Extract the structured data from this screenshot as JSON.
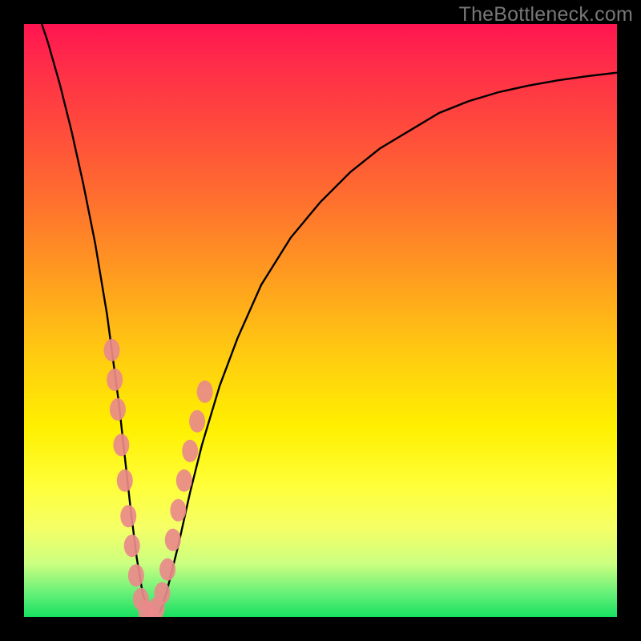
{
  "watermark": "TheBottleneck.com",
  "chart_data": {
    "type": "line",
    "title": "",
    "xlabel": "",
    "ylabel": "",
    "xlim": [
      0,
      100
    ],
    "ylim": [
      0,
      100
    ],
    "grid": false,
    "series": [
      {
        "name": "bottleneck-curve",
        "x": [
          0,
          2,
          4,
          6,
          8,
          10,
          12,
          14,
          16,
          17,
          18,
          19,
          20,
          21,
          22,
          23,
          24,
          26,
          28,
          30,
          33,
          36,
          40,
          45,
          50,
          55,
          60,
          65,
          70,
          75,
          80,
          85,
          90,
          95,
          100
        ],
        "values": [
          108,
          103,
          97,
          90,
          82,
          73,
          63,
          51,
          36,
          27,
          18,
          10,
          4,
          1,
          0,
          1,
          4,
          12,
          21,
          29,
          39,
          47,
          56,
          64,
          70,
          75,
          79,
          82,
          85,
          87,
          88.5,
          89.6,
          90.5,
          91.2,
          91.8
        ]
      }
    ],
    "markers": {
      "name": "highlighted-points",
      "color": "#e98a8a",
      "points": [
        {
          "x": 14.8,
          "y": 45
        },
        {
          "x": 15.3,
          "y": 40
        },
        {
          "x": 15.8,
          "y": 35
        },
        {
          "x": 16.4,
          "y": 29
        },
        {
          "x": 17.0,
          "y": 23
        },
        {
          "x": 17.6,
          "y": 17
        },
        {
          "x": 18.2,
          "y": 12
        },
        {
          "x": 18.9,
          "y": 7
        },
        {
          "x": 19.7,
          "y": 3
        },
        {
          "x": 20.6,
          "y": 1
        },
        {
          "x": 21.5,
          "y": 0.5
        },
        {
          "x": 22.4,
          "y": 1.5
        },
        {
          "x": 23.3,
          "y": 4
        },
        {
          "x": 24.2,
          "y": 8
        },
        {
          "x": 25.1,
          "y": 13
        },
        {
          "x": 26.0,
          "y": 18
        },
        {
          "x": 27.0,
          "y": 23
        },
        {
          "x": 28.0,
          "y": 28
        },
        {
          "x": 29.2,
          "y": 33
        },
        {
          "x": 30.5,
          "y": 38
        }
      ]
    },
    "gradient_stops": [
      {
        "pos": 0,
        "color": "#ff1450"
      },
      {
        "pos": 50,
        "color": "#ffcc10"
      },
      {
        "pos": 80,
        "color": "#ffff3a"
      },
      {
        "pos": 100,
        "color": "#18e060"
      }
    ]
  }
}
